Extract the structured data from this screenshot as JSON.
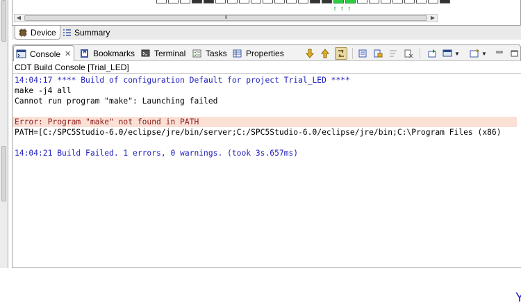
{
  "editor": {
    "pin_marks": [
      "t",
      "t",
      "t"
    ],
    "scroll_thumb_grip": "III",
    "tabs": [
      {
        "label": "Device",
        "icon": "device-chip-icon",
        "active": true
      },
      {
        "label": "Summary",
        "icon": "list-icon",
        "active": false
      }
    ]
  },
  "view": {
    "tabs": [
      {
        "label": "Console",
        "icon": "console-icon",
        "active": true,
        "close": "✕"
      },
      {
        "label": "Bookmarks",
        "icon": "bookmarks-icon"
      },
      {
        "label": "Terminal",
        "icon": "terminal-icon"
      },
      {
        "label": "Tasks",
        "icon": "tasks-icon"
      },
      {
        "label": "Properties",
        "icon": "properties-icon"
      }
    ],
    "toolbar": [
      "scroll-down-icon",
      "scroll-up-icon",
      "link-icon",
      "console-properties-icon",
      "lock-icon",
      "word-wrap-icon",
      "clear-console-icon",
      "pin-console-icon",
      "display-console-icon",
      "open-console-icon",
      "view-menu-icon",
      "minimize-icon",
      "maximize-icon"
    ]
  },
  "console": {
    "title": "CDT Build Console [Trial_LED]",
    "lines": [
      {
        "text": "14:04:17 **** Build of configuration Default for project Trial_LED ****",
        "style": "blue"
      },
      {
        "text": "make -j4 all",
        "style": "black"
      },
      {
        "text": "Cannot run program \"make\": Launching failed",
        "style": "black"
      },
      {
        "text": "",
        "style": "black"
      },
      {
        "text": "Error: Program \"make\" not found in PATH",
        "style": "err"
      },
      {
        "text": "PATH=[C:/SPC5Studio-6.0/eclipse/jre/bin/server;C:/SPC5Studio-6.0/eclipse/jre/bin;C:\\Program Files (x86)",
        "style": "black"
      },
      {
        "text": "",
        "style": "black"
      },
      {
        "text": "14:04:21 Build Failed. 1 errors, 0 warnings. (took 3s.657ms)",
        "style": "blue"
      }
    ]
  },
  "colors": {
    "accent_blue": "#1c1cbf",
    "error_bg": "#fbe0d6",
    "pin_green": "#2ecc40"
  },
  "bottom_glyph": "Y"
}
